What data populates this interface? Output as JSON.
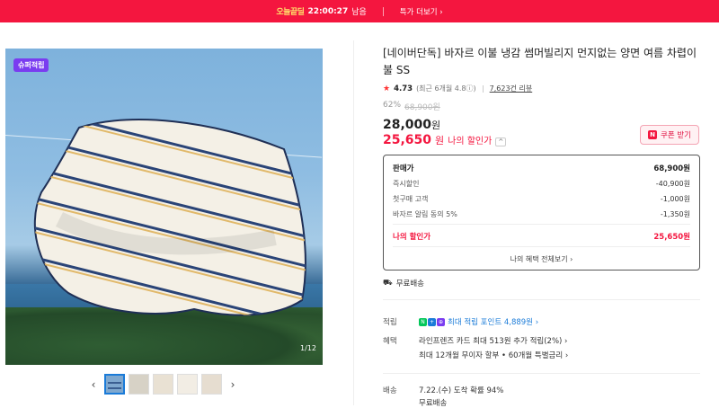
{
  "promo": {
    "badge": "오늘끝딜",
    "time": "22:00:27",
    "time_suffix": "남음",
    "more_label": "특가 더보기 ›"
  },
  "gallery": {
    "chip": "슈퍼적립",
    "count": "1/12",
    "prev": "‹",
    "next": "›",
    "thumbs": 5
  },
  "product": {
    "title": "[네이버단독] 바자르 이불 냉감 썸머빌리지 먼지없는 양면 여름 차렵이불 SS",
    "rating_star": "★",
    "rating": "4.73",
    "rating_sub": "(최근 6개월 4.8ⓘ)",
    "review": "7,623건 리뷰",
    "discount_pct": "62%",
    "original_price": "68,900원",
    "sale_price": "28,000",
    "won": "원",
    "my_price": "25,650",
    "my_price_label": "나의 할인가",
    "caret": "^",
    "coupon_logo": "N",
    "coupon_label": "쿠폰 받기"
  },
  "breakdown": {
    "rows": [
      {
        "label": "판매가",
        "value": "68,900원"
      },
      {
        "label": "즉시할인",
        "value": "-40,900원"
      },
      {
        "label": "첫구매 고객",
        "value": "-1,000원"
      },
      {
        "label": "바자르 알림 동의 5%",
        "value": "-1,350원"
      }
    ],
    "mine": {
      "label": "나의 할인가",
      "value": "25,650원"
    },
    "more": "나의 혜택 전체보기 ›"
  },
  "shipping": {
    "icon": "⛟",
    "label": "무료배송"
  },
  "benefits": {
    "point_label": "적립",
    "point_value": "최대 적립 포인트 4,889원 ›",
    "benefit_label": "혜택",
    "benefit_line1": "라인프렌즈 카드 최대 513원 추가 적립(2%) ›",
    "benefit_line2": "최대 12개월 무이자 할부 • 60개월 특별금리 ›",
    "delivery_label": "배송",
    "delivery_line1": "7.22.(수) 도착 확률 94%",
    "delivery_line2": "무료배송"
  },
  "colors": {
    "accent": "#f4163f",
    "link": "#1a7bd8"
  }
}
